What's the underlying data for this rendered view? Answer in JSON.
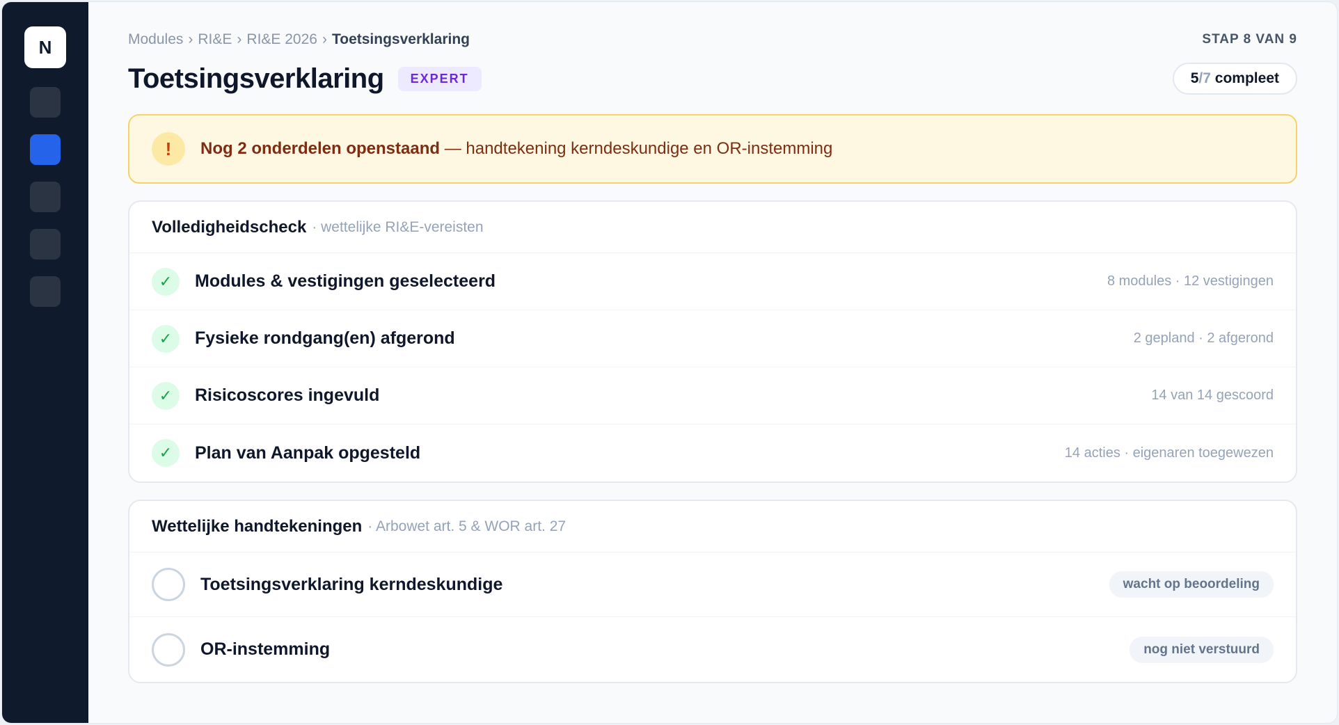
{
  "sidebar": {
    "logo": "N",
    "items": [
      {
        "name": "nav-item-1",
        "active": false
      },
      {
        "name": "nav-item-2",
        "active": true
      },
      {
        "name": "nav-item-3",
        "active": false
      },
      {
        "name": "nav-item-4",
        "active": false
      },
      {
        "name": "nav-item-5",
        "active": false
      }
    ]
  },
  "breadcrumb": {
    "items": [
      "Modules",
      "RI&E",
      "RI&E 2026"
    ],
    "current": "Toetsingsverklaring",
    "separator": "›"
  },
  "step": "STAP 8 VAN 9",
  "header": {
    "title": "Toetsingsverklaring",
    "badge": "EXPERT",
    "complete_done": "5",
    "complete_slash": "/",
    "complete_total": "7",
    "complete_label": "compleet"
  },
  "warning": {
    "icon": "!",
    "strong": "Nog 2 onderdelen openstaand",
    "rest": " — handtekening kerndeskundige en OR-instemming"
  },
  "completeness": {
    "title": "Volledigheidscheck",
    "subtitle": "· wettelijke RI&E-vereisten",
    "rows": [
      {
        "label": "Modules & vestigingen geselecteerd",
        "meta": "8 modules · 12 vestigingen"
      },
      {
        "label": "Fysieke rondgang(en) afgerond",
        "meta": "2 gepland · 2 afgerond"
      },
      {
        "label": "Risicoscores ingevuld",
        "meta": "14 van 14 gescoord"
      },
      {
        "label": "Plan van Aanpak opgesteld",
        "meta": "14 acties · eigenaren toegewezen"
      }
    ]
  },
  "signatures": {
    "title": "Wettelijke handtekeningen",
    "subtitle": "· Arbowet art. 5 & WOR art. 27",
    "rows": [
      {
        "label": "Toetsingsverklaring kerndeskundige",
        "status": "wacht op beoordeling"
      },
      {
        "label": "OR-instemming",
        "status": "nog niet verstuurd"
      }
    ]
  },
  "icons": {
    "check": "✓",
    "warning": "!"
  },
  "colors": {
    "sidebar": "#0f1b2d",
    "accent": "#2563eb",
    "success": "#16a34a",
    "warning_border": "#f5d36a",
    "expert": "#6d28d9"
  }
}
